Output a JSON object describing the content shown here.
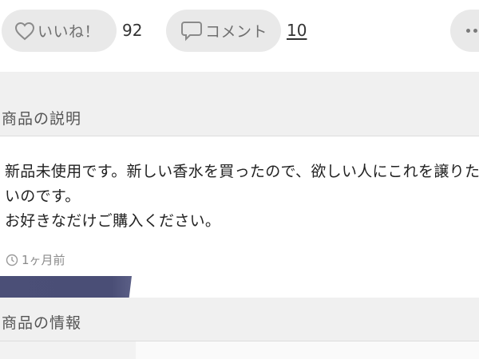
{
  "actions": {
    "like": {
      "icon": "heart-icon",
      "label": "いいね！",
      "count": "92"
    },
    "comment": {
      "icon": "speech-bubble-icon",
      "label": "コメント",
      "count": "10"
    },
    "more": {
      "icon": "more-icon"
    }
  },
  "sections": {
    "description": {
      "title": "商品の説明",
      "text": "新品未使用です。新しい香水を買ったので、欲しい人にこれを譲りた\nいのです。\nお好きなだけご購入ください。",
      "timestamp": "1ヶ月前",
      "timestamp_icon": "clock-icon"
    },
    "info": {
      "title": "商品の情報"
    }
  }
}
